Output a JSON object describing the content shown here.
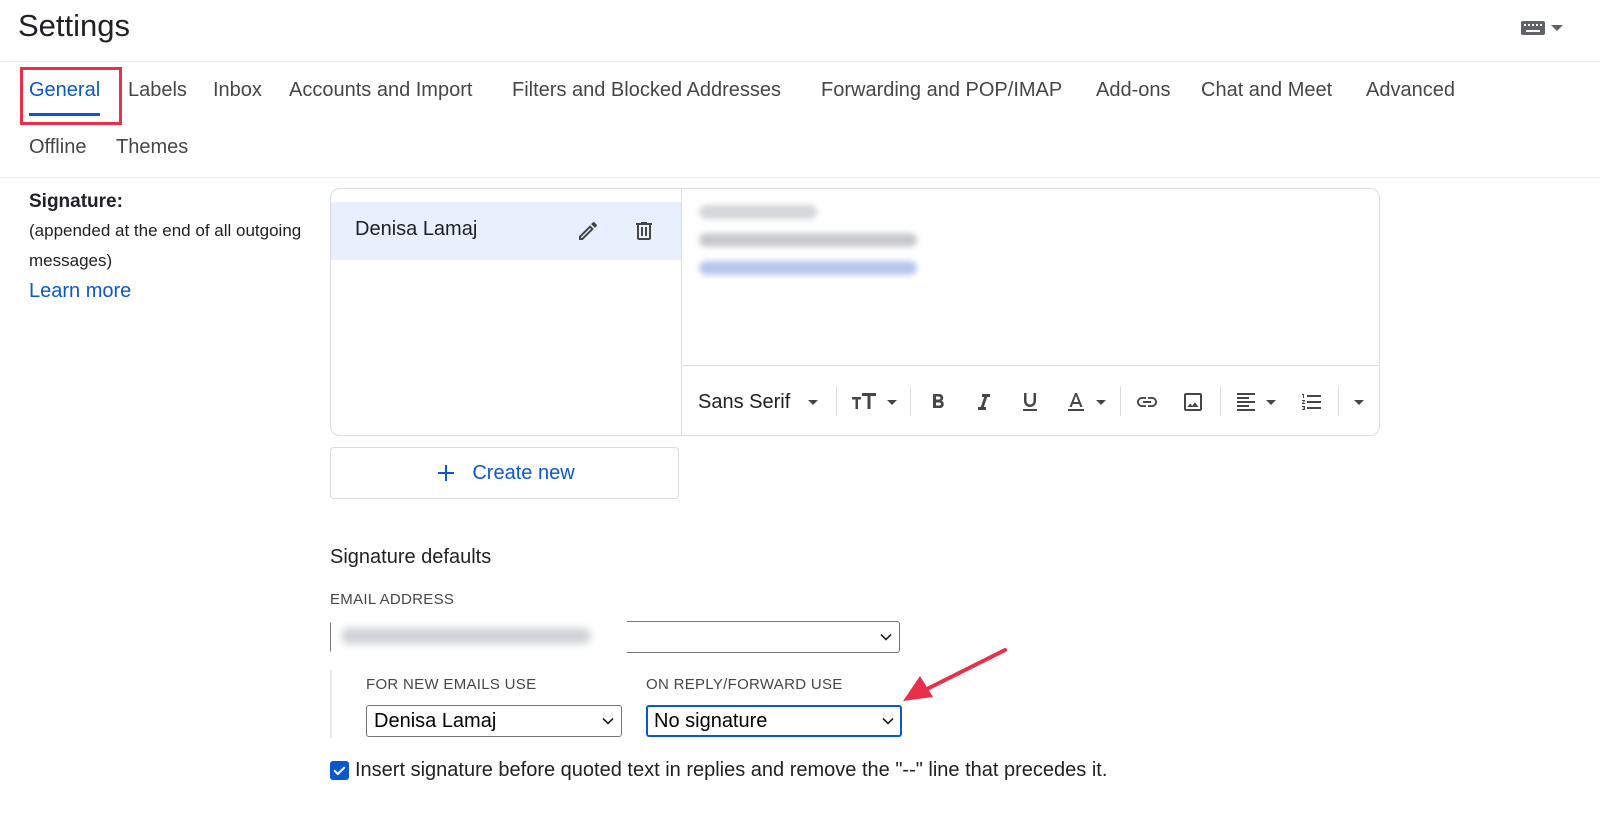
{
  "header": {
    "title": "Settings"
  },
  "tabs": [
    {
      "label": "General",
      "active": true
    },
    {
      "label": "Labels"
    },
    {
      "label": "Inbox"
    },
    {
      "label": "Accounts and Import"
    },
    {
      "label": "Filters and Blocked Addresses"
    },
    {
      "label": "Forwarding and POP/IMAP"
    },
    {
      "label": "Add-ons"
    },
    {
      "label": "Chat and Meet"
    },
    {
      "label": "Advanced"
    },
    {
      "label": "Offline"
    },
    {
      "label": "Themes"
    }
  ],
  "signature_section": {
    "title": "Signature:",
    "description": "(appended at the end of all outgoing messages)",
    "learn_more": "Learn more"
  },
  "signature_list": [
    {
      "name": "Denisa Lamaj"
    }
  ],
  "editor_toolbar": {
    "font_family": "Sans Serif"
  },
  "create_new_label": "Create new",
  "signature_defaults": {
    "title": "Signature defaults",
    "email_address_label": "EMAIL ADDRESS",
    "for_new_emails_label": "FOR NEW EMAILS USE",
    "for_new_emails_value": "Denisa Lamaj",
    "on_reply_label": "ON REPLY/FORWARD USE",
    "on_reply_value": "No signature"
  },
  "insert_before_quoted": {
    "checked": true,
    "label": "Insert signature before quoted text in replies and remove the \"--\" line that precedes it."
  },
  "colors": {
    "accent": "#0b57d0",
    "highlight": "#e8304a",
    "selected_row": "#e8f0fe"
  }
}
